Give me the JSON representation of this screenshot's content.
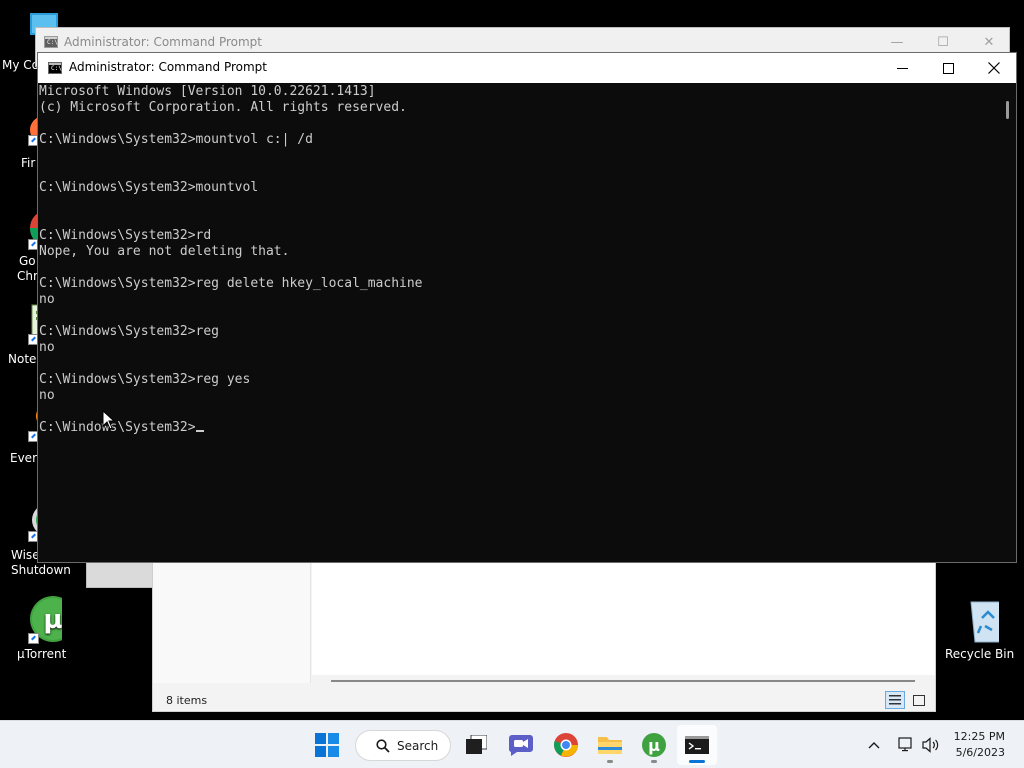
{
  "desktop": {
    "icons": [
      {
        "label": "My Co",
        "icon": "monitor-icon"
      },
      {
        "label": "Fir",
        "icon": "firefox-icon"
      },
      {
        "label": "Go",
        "label2": "Chr",
        "icon": "chrome-icon"
      },
      {
        "label": "Note",
        "icon": "notepad-icon"
      },
      {
        "label": "Ever",
        "icon": "everything-icon"
      },
      {
        "label": "Wise",
        "label2": "Shutdown",
        "icon": "wise-shutdown-icon"
      },
      {
        "label": "µTorrent",
        "icon": "utorrent-icon"
      },
      {
        "label": "Recycle Bin",
        "icon": "recycle-bin-icon"
      }
    ]
  },
  "explorer": {
    "status": "8 items"
  },
  "back_window": {
    "title": "Administrator:  Command Prompt",
    "minimize": "—",
    "maximize": "☐",
    "close": "✕"
  },
  "front_window": {
    "title": "Administrator:  Command Prompt",
    "icon_text": "C:\\"
  },
  "console": {
    "lines": [
      "Microsoft Windows [Version 10.0.22621.1413]",
      "(c) Microsoft Corporation. All rights reserved.",
      "",
      "C:\\Windows\\System32>mountvol c:| /d",
      "",
      "",
      "C:\\Windows\\System32>mountvol",
      "",
      "",
      "C:\\Windows\\System32>rd",
      "Nope, You are not deleting that.",
      "",
      "C:\\Windows\\System32>reg delete hkey_local_machine",
      "no",
      "",
      "C:\\Windows\\System32>reg",
      "no",
      "",
      "C:\\Windows\\System32>reg yes",
      "no",
      "",
      "C:\\Windows\\System32>"
    ]
  },
  "taskbar": {
    "search_label": "Search",
    "time": "12:25 PM",
    "date": "5/6/2023",
    "apps": [
      "start-icon",
      "search-icon",
      "task-view-icon",
      "chat-icon",
      "chrome-icon",
      "file-explorer-icon",
      "utorrent-icon",
      "command-prompt-icon"
    ],
    "tray": [
      "chevron-up-icon",
      "network-icon",
      "volume-icon"
    ]
  },
  "colors": {
    "console_bg": "#0c0c0c",
    "console_fg": "#cccccc",
    "taskbar_bg": "#eef1f6",
    "utorrent_green": "#3fa13f"
  }
}
